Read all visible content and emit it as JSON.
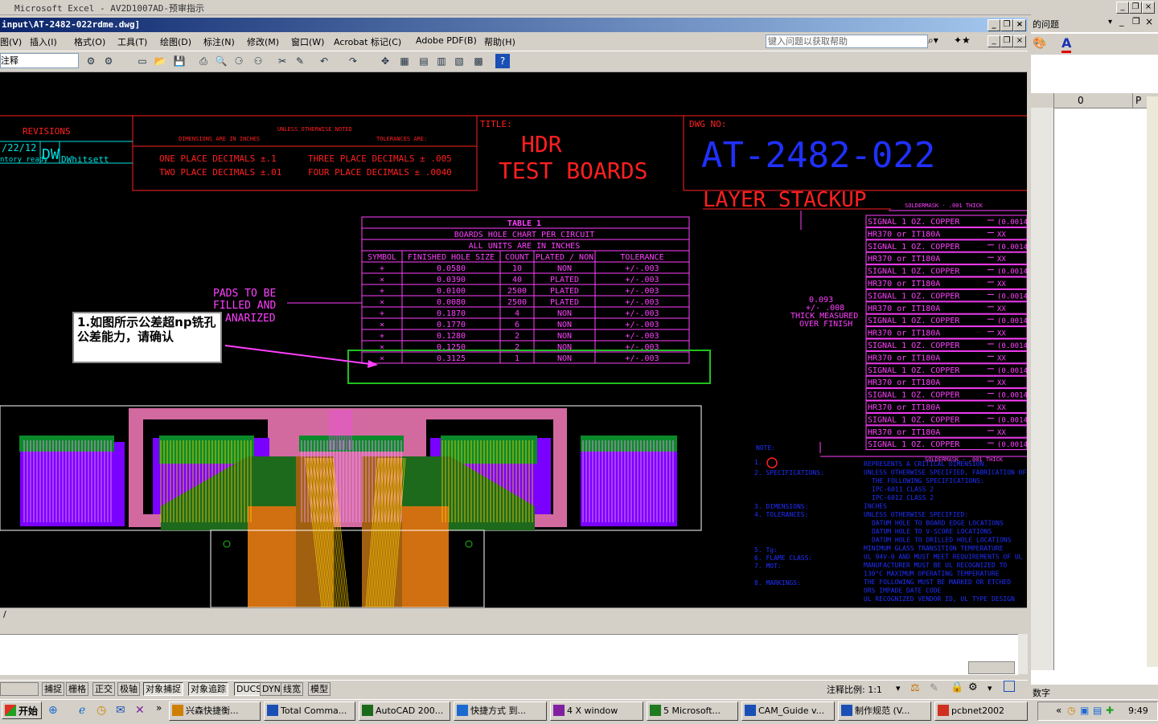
{
  "excel_title": "Microsoft Excel - AV2D1007AD-预审指示",
  "acad_title": "input\\AT-2482-022rdme.dwg]",
  "menus": [
    "图(V)",
    "插入(I)",
    "格式(O)",
    "工具(T)",
    "绘图(D)",
    "标注(N)",
    "修改(M)",
    "窗口(W)",
    "Acrobat 标记(C)",
    "Adobe PDF(B)",
    "帮助(H)"
  ],
  "help_placeholder": "键入问题以获取帮助",
  "layer_value": "注释",
  "excel_question": "的问题",
  "excel_col_headers": [
    "0",
    "P"
  ],
  "excel_status": "数字",
  "revisions": {
    "title": "REVISIONS",
    "date": "/22/12",
    "initials": "DW",
    "name": "DWhitsett",
    "note": "ntory ready"
  },
  "tolerances": {
    "header1": "UNLESS OTHERWISE NOTED",
    "header2": "DIMENSIONS ARE IN INCHES",
    "header3": "TOLERANCES ARE:",
    "one": "ONE PLACE DECIMALS ±.1",
    "two": "TWO PLACE DECIMALS ±.01",
    "three": "THREE PLACE DECIMALS ± .005",
    "four": "FOUR PLACE DECIMALS ± .0040"
  },
  "title_block": {
    "label": "TITLE:",
    "line1": "HDR",
    "line2": "TEST BOARDS",
    "dwg_label": "DWG NO:",
    "dwg_no": "AT-2482-022"
  },
  "layer_stackup": "LAYER STACKUP",
  "soldermask_top": "SOLDERMASK - .001 THICK",
  "soldermask_bottom": "SOLDERMASK - .001 THICK",
  "thickness": {
    "l1": "0.093",
    "l2": "+/- .008",
    "l3": "THICK MEASURED",
    "l4": "OVER FINISH"
  },
  "stack_layers": [
    {
      "name": "SIGNAL 1 OZ. COPPER",
      "val": "(0.0014)"
    },
    {
      "name": "HR370 or IT180A",
      "val": "XX"
    },
    {
      "name": "SIGNAL 1 OZ. COPPER",
      "val": "(0.0014)"
    },
    {
      "name": "HR370 or IT180A",
      "val": "XX"
    },
    {
      "name": "SIGNAL 1 OZ. COPPER",
      "val": "(0.0014)"
    },
    {
      "name": "HR370 or IT180A",
      "val": "XX"
    },
    {
      "name": "SIGNAL 1 OZ. COPPER",
      "val": "(0.0014)"
    },
    {
      "name": "HR370 or IT180A",
      "val": "XX"
    },
    {
      "name": "SIGNAL 1 OZ. COPPER",
      "val": "(0.0014)"
    },
    {
      "name": "HR370 or IT180A",
      "val": "XX"
    },
    {
      "name": "SIGNAL 1 OZ. COPPER",
      "val": "(0.0014)"
    },
    {
      "name": "HR370 or IT180A",
      "val": "XX"
    },
    {
      "name": "SIGNAL 1 OZ. COPPER",
      "val": "(0.0014)"
    },
    {
      "name": "HR370 or IT180A",
      "val": "XX"
    },
    {
      "name": "SIGNAL 1 OZ. COPPER",
      "val": "(0.0014)"
    },
    {
      "name": "HR370 or IT180A",
      "val": "XX"
    },
    {
      "name": "SIGNAL 1 OZ. COPPER",
      "val": "(0.0014)"
    },
    {
      "name": "HR370 or IT180A",
      "val": "XX"
    },
    {
      "name": "SIGNAL 1 OZ. COPPER",
      "val": "(0.0014)"
    }
  ],
  "hole_table": {
    "title": "TABLE 1",
    "subtitle1": "BOARDS HOLE CHART PER CIRCUIT",
    "subtitle2": "ALL UNITS ARE IN INCHES",
    "columns": [
      "SYMBOL",
      "FINISHED HOLE SIZE",
      "COUNT",
      "PLATED / NON",
      "TOLERANCE"
    ],
    "rows": [
      [
        "+",
        "0.0580",
        "10",
        "NON",
        "+/-.003"
      ],
      [
        "×",
        "0.0390",
        "40",
        "PLATED",
        "+/-.003"
      ],
      [
        "+",
        "0.0100",
        "2500",
        "PLATED",
        "+/-.003"
      ],
      [
        "×",
        "0.0080",
        "2500",
        "PLATED",
        "+/-.003"
      ],
      [
        "+",
        "0.1870",
        "4",
        "NON",
        "+/-.003"
      ],
      [
        "×",
        "0.1770",
        "6",
        "NON",
        "+/-.003"
      ],
      [
        "+",
        "0.1280",
        "2",
        "NON",
        "+/-.003"
      ],
      [
        "×",
        "0.1250",
        "2",
        "NON",
        "+/-.003"
      ],
      [
        "×",
        "0.3125",
        "1",
        "NON",
        "+/-.003"
      ]
    ]
  },
  "pads_note": [
    "PADS TO BE",
    "FILLED AND",
    "ANARIZED"
  ],
  "callout": "1.如图所示公差超np铣孔公差能力，请确认",
  "notes": {
    "title": "NOTE:",
    "labels": [
      "1.",
      "2. SPECIFICATIONS:",
      "3. DIMENSIONS:",
      "4. TOLERANCES:",
      "5. Tg:",
      "6. FLAME CLASS:",
      "7. MOT:",
      "8. MARKINGS:"
    ],
    "texts": [
      "REPRESENTS A CRITICAL DIMENSION.",
      "UNLESS OTHERWISE SPECIFIED, FABRICATION OF THIS",
      "THE FOLLOWING SPECIFICATIONS:",
      "IPC-6011 CLASS 2",
      "IPC-6012 CLASS 2",
      "INCHES",
      "UNLESS OTHERWISE SPECIFIED:",
      "DATUM HOLE TO BOARD EDGE LOCATIONS",
      "DATUM HOLE TO V-SCORE LOCATIONS",
      "DATUM HOLE TO DRILLED HOLE LOCATIONS",
      "MINIMUM GLASS TRANSITION TEMPERATURE",
      "UL 94V-0 AND MUST MEET REQUIREMENTS OF UL",
      "MANUFACTURER MUST BE UL RECOGNIZED TO",
      "130°C MAXIMUM OPERATING TEMPERATURE",
      "THE FOLLOWING MUST BE MARKED OR ETCHED",
      "ORS IMPADE DATE CODE",
      "UL RECOGNIZED VENDOR ID, UL TYPE DESIGN"
    ]
  },
  "cmd_prompt": "/",
  "status_buttons": [
    "捕捉",
    "栅格",
    "正交",
    "极轴",
    "对象捕捉",
    "对象追踪",
    "DUCS",
    "DYN",
    "线宽",
    "模型"
  ],
  "status_scale": "注释比例: 1:1",
  "taskbar": {
    "start": "开始",
    "tasks": [
      "兴森快捷衡...",
      "Total Comma...",
      "AutoCAD 200...",
      "快捷方式 到...",
      "4 X window",
      "5 Microsoft...",
      "CAM_Guide v...",
      "制作规范 (V...",
      "pcbnet2002"
    ],
    "clock": "9:49"
  },
  "colors": {
    "magenta": "#ff40ff",
    "red": "#ff2020",
    "blue": "#2030ff",
    "green": "#20c020",
    "cyan": "#00e0e0"
  }
}
